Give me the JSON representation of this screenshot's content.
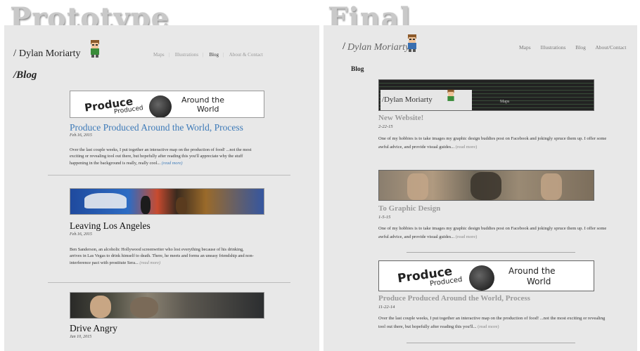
{
  "labels": {
    "prototype": "Prototype",
    "final": "Final"
  },
  "prototype": {
    "brand_pipe": "/",
    "brand": "Dylan Moriarty",
    "nav": [
      "Maps",
      "Illustrations",
      "Blog",
      "About & Contact"
    ],
    "nav_active": "Blog",
    "page_title_pipe": "/",
    "page_title": "Blog",
    "posts": [
      {
        "title": "Produce Produced Around the World, Process",
        "date": "Feb.16, 2015",
        "excerpt": "Over the last couple weeks, I put together an interactive map on the production of food! ...not the most exciting or revealing tool out there, but hopefully after reading this you'll appreciate why the stuff happening in the background is really, really cool...",
        "more": "(read more)",
        "title_color": "#3d7ab8"
      },
      {
        "title": "Leaving Los Angeles",
        "date": "Feb.16, 2015",
        "excerpt": "Ben Sanderson, an alcoholic Hollywood screenwriter who lost everything because of his drinking, arrives in Las Vegas to drink himself to death. There, he meets and forms an uneasy friendship and non-interference pact with prostitute Sera...",
        "more": "(read more)",
        "title_color": "#111111"
      },
      {
        "title": "Drive Angry",
        "date": "Jan 10, 2015",
        "title_color": "#111111"
      }
    ],
    "banner_words": {
      "w1": "Produce",
      "w2": "Produced",
      "w3": "Around the",
      "w4": "World"
    }
  },
  "final": {
    "brand_pipe": "/",
    "brand": "Dylan Moriarty",
    "nav": [
      "Maps",
      "Illustrations",
      "Blog",
      "About/Contact"
    ],
    "page_title": "Blog",
    "posts": [
      {
        "title": "New Website!",
        "date": "2-22-15",
        "excerpt": "One of my hobbies is to take images my graphic design buddies post on Facebook and jokingly spruce them up. I offer some awful advice, and provide visual guides...",
        "more": "(read more)",
        "thumb_brand": "/Dylan Moriarty",
        "thumb_nav": "Maps"
      },
      {
        "title": "To Graphic Design",
        "date": "1-5-15",
        "excerpt": "One of my hobbies is to take images my graphic design buddies post on Facebook and jokingly spruce them up. I offer some awful advice, and provide visual guides...",
        "more": "(read more)"
      },
      {
        "title": "Produce Produced Around the World, Process",
        "date": "11-22-14",
        "excerpt": "Over the last couple weeks, I put together an interactive map on the production of food! ...not the most exciting or revealing tool out there, but hopefully after reading this you'll...",
        "more": "(read more)"
      }
    ]
  },
  "colors": {
    "panel_bg": "#e8e8e8",
    "link_blue": "#3d7ab8",
    "final_title_gray": "#9a9a9a"
  }
}
